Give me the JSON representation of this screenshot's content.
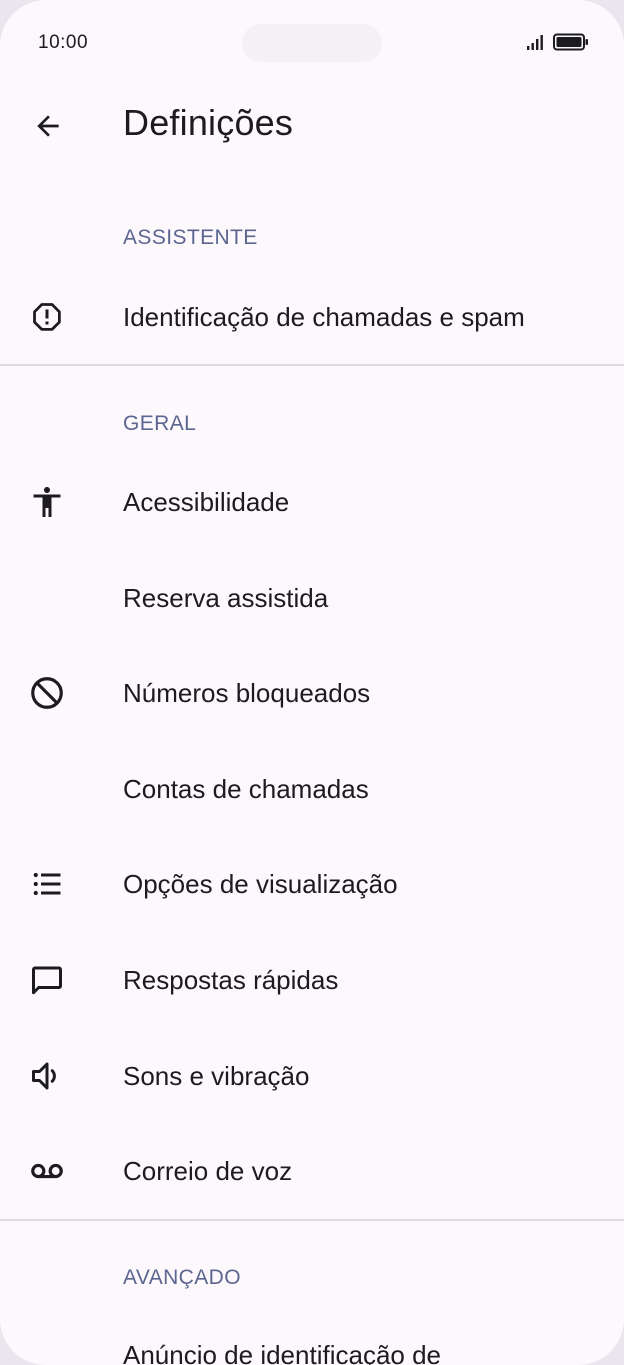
{
  "status_bar": {
    "time": "10:00"
  },
  "app_bar": {
    "title": "Definições"
  },
  "sections": [
    {
      "header": "ASSISTENTE",
      "items": [
        {
          "label": "Identificação de chamadas e spam",
          "icon": "spam-alert-icon"
        }
      ]
    },
    {
      "header": "GERAL",
      "items": [
        {
          "label": "Acessibilidade",
          "icon": "accessibility-icon"
        },
        {
          "label": "Reserva assistida",
          "icon": ""
        },
        {
          "label": "Números bloqueados",
          "icon": "block-icon"
        },
        {
          "label": "Contas de chamadas",
          "icon": ""
        },
        {
          "label": "Opções de visualização",
          "icon": "list-icon"
        },
        {
          "label": "Respostas rápidas",
          "icon": "message-icon"
        },
        {
          "label": "Sons e vibração",
          "icon": "volume-icon"
        },
        {
          "label": "Correio de voz",
          "icon": "voicemail-icon"
        }
      ]
    },
    {
      "header": "AVANÇADO",
      "items": [
        {
          "label": "Anúncio de identificação de",
          "icon": ""
        }
      ]
    }
  ],
  "colors": {
    "background": "#fdf8fc",
    "section_header": "#5b6590",
    "text": "#1c1b1f",
    "divider": "#dcd9df"
  }
}
